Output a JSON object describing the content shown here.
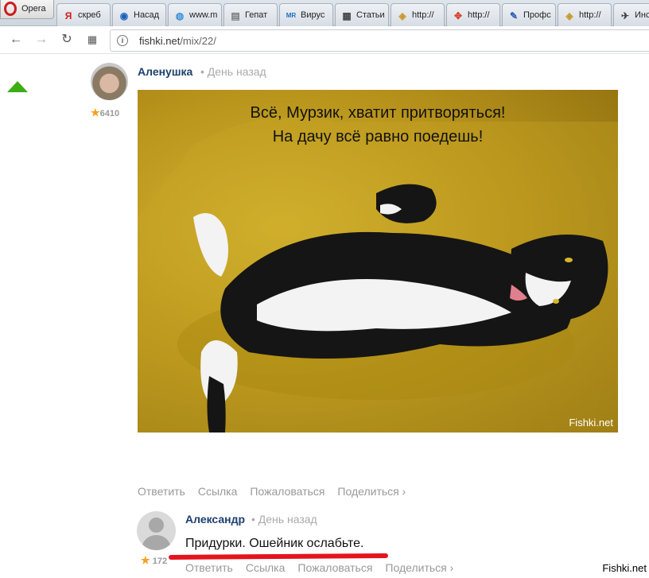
{
  "browser": {
    "app_label": "Opera",
    "tabs": [
      {
        "title": "скреб",
        "icon": "yandex-icon",
        "icon_color": "#d31d1d"
      },
      {
        "title": "Насад",
        "icon": "circle-favicon-icon",
        "icon_color": "#1b5fbf"
      },
      {
        "title": "www.m",
        "icon": "globe-icon",
        "icon_color": "#3a8fd6"
      },
      {
        "title": "Гепат",
        "icon": "document-icon",
        "icon_color": "#777777"
      },
      {
        "title": "Вирус",
        "icon": "mr-icon",
        "icon_color": "#1b6fbf"
      },
      {
        "title": "Статьи",
        "icon": "book-icon",
        "icon_color": "#444444"
      },
      {
        "title": "http://",
        "icon": "package-icon",
        "icon_color": "#c79a2b"
      },
      {
        "title": "http://",
        "icon": "puzzle-icon",
        "icon_color": "#d4462b"
      },
      {
        "title": "Профс",
        "icon": "pen-icon",
        "icon_color": "#2a5db0"
      },
      {
        "title": "http://",
        "icon": "package-icon",
        "icon_color": "#c79a2b"
      },
      {
        "title": "Инс",
        "icon": "satellite-icon",
        "icon_color": "#444444"
      }
    ],
    "url_host": "fishki.net",
    "url_path": "/mix/22/"
  },
  "post": {
    "author": "Аленушка",
    "time": "• День назад",
    "rating": "6410",
    "caption_line1": "Всё, Мурзик, хватит притворяться!",
    "caption_line2": "На дачу всё равно поедешь!",
    "watermark": "Fishki.net",
    "actions": [
      "Ответить",
      "Ссылка",
      "Пожаловаться",
      "Поделиться ›"
    ]
  },
  "reply": {
    "author": "Александр",
    "time": "• День назад",
    "rating": "172",
    "text": "Придурки. Ошейник ослабьте.",
    "actions": [
      "Ответить",
      "Ссылка",
      "Пожаловаться",
      "Поделиться ›"
    ]
  },
  "corner_watermark": "Fishki.net",
  "colors": {
    "upvote": "#3cad15",
    "author": "#1d3f6e",
    "highlight": "#e5141c",
    "star": "#f7a11f"
  }
}
